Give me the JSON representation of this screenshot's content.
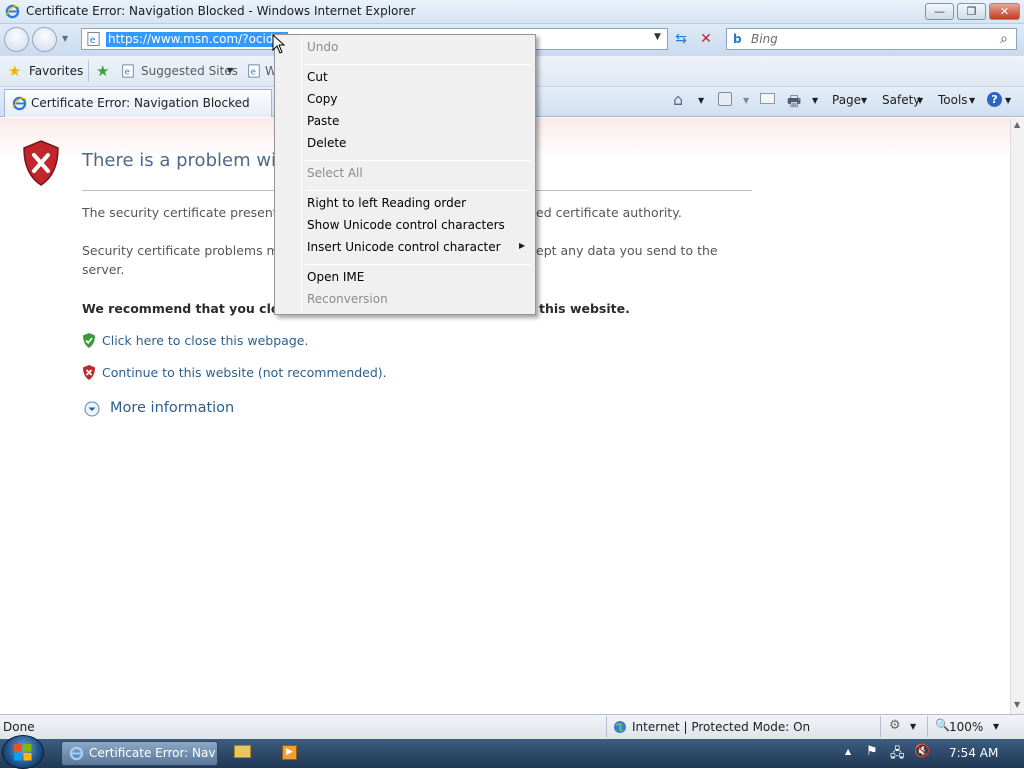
{
  "window": {
    "title": "Certificate Error: Navigation Blocked - Windows Internet Explorer",
    "minimize": "—",
    "restore": "❐",
    "close": "✕"
  },
  "nav": {
    "url": "https://www.msn.com/?ocid=i",
    "search_placeholder": "Bing",
    "search_brand": "b"
  },
  "favbar": {
    "favorites": "Favorites",
    "suggested_sites": "Suggested Sites",
    "web_slice": "W"
  },
  "tab": {
    "label": "Certificate Error: Navigation Blocked"
  },
  "toolbar": {
    "page": "Page",
    "safety": "Safety",
    "tools": "Tools"
  },
  "content": {
    "heading": "There is a problem with",
    "para1_left": "The security certificate presente",
    "para1_right": "ed certificate authority.",
    "para2_left": "Security certificate problems ma",
    "para2_right": "ept any data you send to the",
    "para2_line2": "server.",
    "recommend_left": "We recommend that you clo",
    "recommend_right": "this website.",
    "close_link": "Click here to close this webpage.",
    "continue_link": "Continue to this website (not recommended).",
    "more_info": "More information"
  },
  "context_menu": {
    "undo": "Undo",
    "cut": "Cut",
    "copy": "Copy",
    "paste": "Paste",
    "delete": "Delete",
    "select_all": "Select All",
    "rtl": "Right to left Reading order",
    "show_unicode": "Show Unicode control characters",
    "insert_unicode": "Insert Unicode control character",
    "open_ime": "Open IME",
    "reconversion": "Reconversion"
  },
  "status": {
    "done": "Done",
    "zone": "Internet | Protected Mode: On",
    "zoom": "100%"
  },
  "taskbar": {
    "window_button": "Certificate Error: Nav...",
    "clock": "7:54 AM"
  },
  "colors": {
    "link": "#2c5f91",
    "heading": "#4d6a88",
    "selection": "#3399ff",
    "error_red": "#c0262c",
    "ok_green": "#3a9a3a"
  }
}
